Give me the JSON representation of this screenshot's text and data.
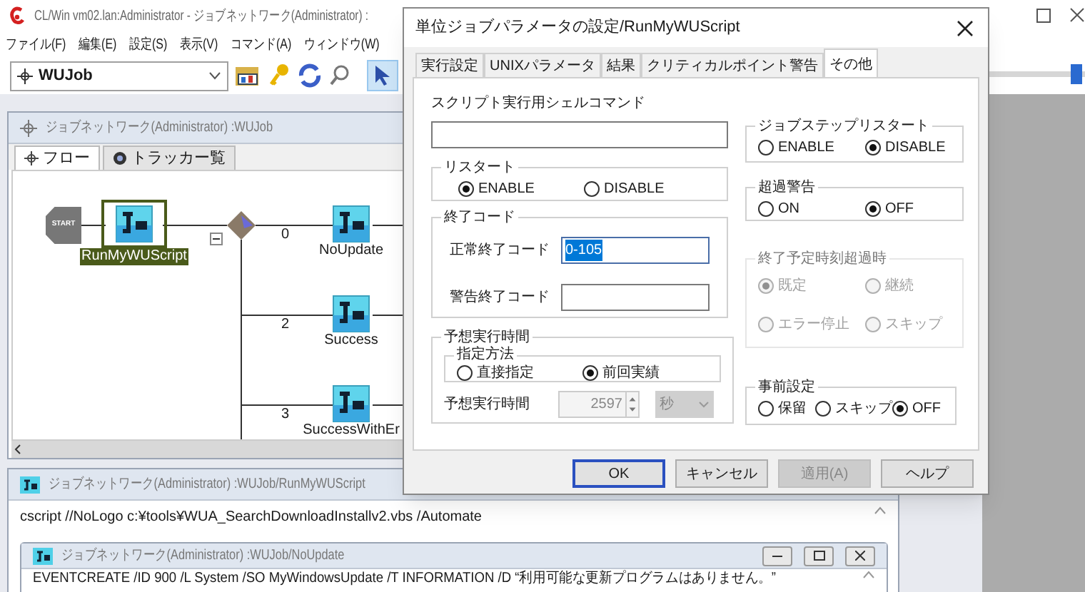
{
  "main_window": {
    "title": "CL/Win vm02.lan:Administrator - ジョブネットワーク(Administrator) :",
    "menu": [
      "ファイル(F)",
      "編集(E)",
      "設定(S)",
      "表示(V)",
      "コマンド(A)",
      "ウィンドウ(W)"
    ],
    "job_selector": "WUJob",
    "zoom_slider": {
      "level": 0.92
    }
  },
  "network_window": {
    "title": "ジョブネットワーク(Administrator) :WUJob",
    "tabs": [
      {
        "label": "フロー",
        "selected": true
      },
      {
        "label": "トラッカー覧",
        "selected": false
      }
    ],
    "nodes": [
      {
        "kind": "start",
        "label": "START",
        "selected": false
      },
      {
        "kind": "job",
        "label": "RunMyWUScript",
        "selected": true
      },
      {
        "kind": "job",
        "label": "NoUpdate",
        "selected": false
      },
      {
        "kind": "job",
        "label": "Success",
        "selected": false
      },
      {
        "kind": "job",
        "label": "SuccessWithEr",
        "selected": false
      }
    ],
    "branch_labels": [
      "0",
      "2",
      "3"
    ]
  },
  "script_window": {
    "title": "ジョブネットワーク(Administrator) :WUJob/RunMyWUScript",
    "text": "cscript //NoLogo c:¥tools¥WUA_SearchDownloadInstallv2.vbs /Automate"
  },
  "noupdate_window": {
    "title": "ジョブネットワーク(Administrator) :WUJob/NoUpdate",
    "text": "EVENTCREATE /ID 900 /L System /SO MyWindowsUpdate /T INFORMATION /D “利用可能な更新プログラムはありません。”"
  },
  "dialog": {
    "title": "単位ジョブパラメータの設定/RunMyWUScript",
    "tabs": [
      {
        "label": "実行設定",
        "selected": false
      },
      {
        "label": "UNIXパラメータ",
        "selected": false
      },
      {
        "label": "結果",
        "selected": false
      },
      {
        "label": "クリティカルポイント警告",
        "selected": false
      },
      {
        "label": "その他",
        "selected": true
      }
    ],
    "shell_command": {
      "label": "スクリプト実行用シェルコマンド"
    },
    "restart": {
      "title": "リスタート",
      "disabled": false,
      "options": [
        {
          "label": "ENABLE",
          "selected": true
        },
        {
          "label": "DISABLE",
          "selected": false
        }
      ]
    },
    "exit_codes": {
      "title": "終了コード",
      "fields": [
        {
          "label": "正常終了コード",
          "value": "0-105",
          "highlighted": true
        },
        {
          "label": "警告終了コード",
          "highlighted": false
        }
      ]
    },
    "expected_time": {
      "title": "予想実行時間",
      "method": {
        "title": "指定方法",
        "disabled": false,
        "options": [
          {
            "label": "直接指定",
            "selected": false
          },
          {
            "label": "前回実績",
            "selected": true
          }
        ]
      },
      "label": "予想実行時間",
      "value": "2597",
      "unit": "秒",
      "disabled": true
    },
    "job_step_restart": {
      "title": "ジョブステップリスタート",
      "disabled": false,
      "options": [
        {
          "label": "ENABLE",
          "selected": false
        },
        {
          "label": "DISABLE",
          "selected": true
        }
      ]
    },
    "overrun_warning": {
      "title": "超過警告",
      "disabled": false,
      "options": [
        {
          "label": "ON",
          "selected": false
        },
        {
          "label": "OFF",
          "selected": true
        }
      ]
    },
    "end_time_exceeded": {
      "title": "終了予定時刻超過時",
      "disabled": true,
      "options": [
        {
          "label": "既定",
          "selected": true
        },
        {
          "label": "継続",
          "selected": false
        },
        {
          "label": "エラー停止",
          "selected": false
        },
        {
          "label": "スキップ",
          "selected": false
        }
      ]
    },
    "pre_setting": {
      "title": "事前設定",
      "disabled": false,
      "options": [
        {
          "label": "保留",
          "selected": false
        },
        {
          "label": "スキップ",
          "selected": false
        },
        {
          "label": "OFF",
          "selected": true
        }
      ]
    },
    "buttons": [
      {
        "label": "OK",
        "default": true,
        "disabled": false
      },
      {
        "label": "キャンセル",
        "default": false,
        "disabled": false
      },
      {
        "label": "適用(A)",
        "default": false,
        "disabled": true
      },
      {
        "label": "ヘルプ",
        "default": false,
        "disabled": false
      }
    ]
  }
}
